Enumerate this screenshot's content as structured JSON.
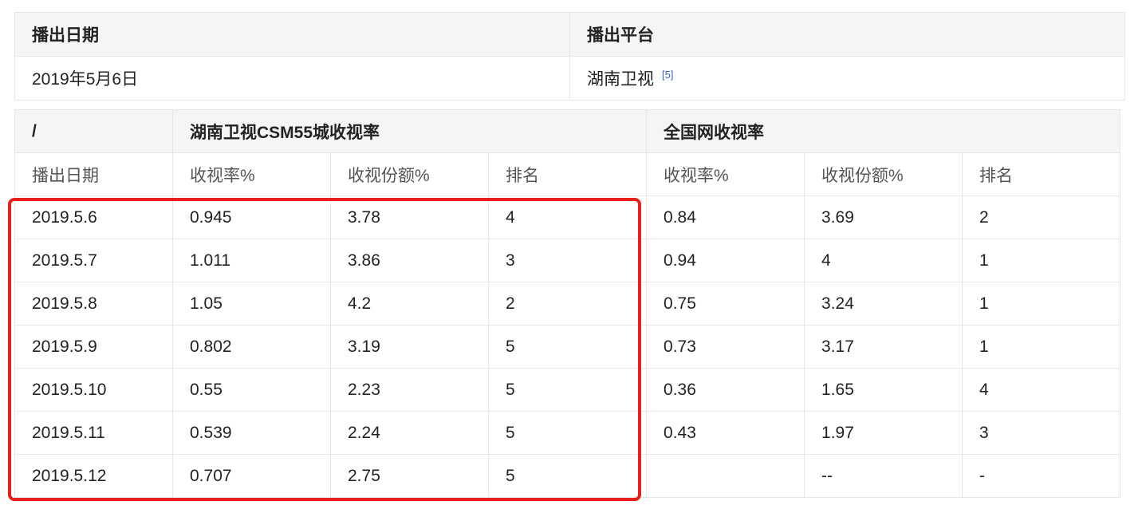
{
  "broadcast": {
    "headers": [
      "播出日期",
      "播出平台"
    ],
    "date": "2019年5月6日",
    "platform": "湖南卫视",
    "ref": "[5]"
  },
  "ratings": {
    "corner": "/",
    "group_csm": "湖南卫视CSM55城收视率",
    "group_national": "全国网收视率",
    "subheaders": [
      "播出日期",
      "收视率%",
      "收视份额%",
      "排名",
      "收视率%",
      "收视份额%",
      "排名"
    ],
    "rows": [
      [
        "2019.5.6",
        "0.945",
        "3.78",
        "4",
        "0.84",
        "3.69",
        "2"
      ],
      [
        "2019.5.7",
        "1.011",
        "3.86",
        "3",
        "0.94",
        "4",
        "1"
      ],
      [
        "2019.5.8",
        "1.05",
        "4.2",
        "2",
        "0.75",
        "3.24",
        "1"
      ],
      [
        "2019.5.9",
        "0.802",
        "3.19",
        "5",
        "0.73",
        "3.17",
        "1"
      ],
      [
        "2019.5.10",
        "0.55",
        "2.23",
        "5",
        "0.36",
        "1.65",
        "4"
      ],
      [
        "2019.5.11",
        "0.539",
        "2.24",
        "5",
        "0.43",
        "1.97",
        "3"
      ],
      [
        "2019.5.12",
        "0.707",
        "2.75",
        "5",
        "",
        "--",
        "-"
      ]
    ]
  },
  "colors": {
    "highlight": "#e8201c",
    "header_bg": "#f5f5f5",
    "border": "#e6e6e6",
    "ref_link": "#3366cc"
  }
}
